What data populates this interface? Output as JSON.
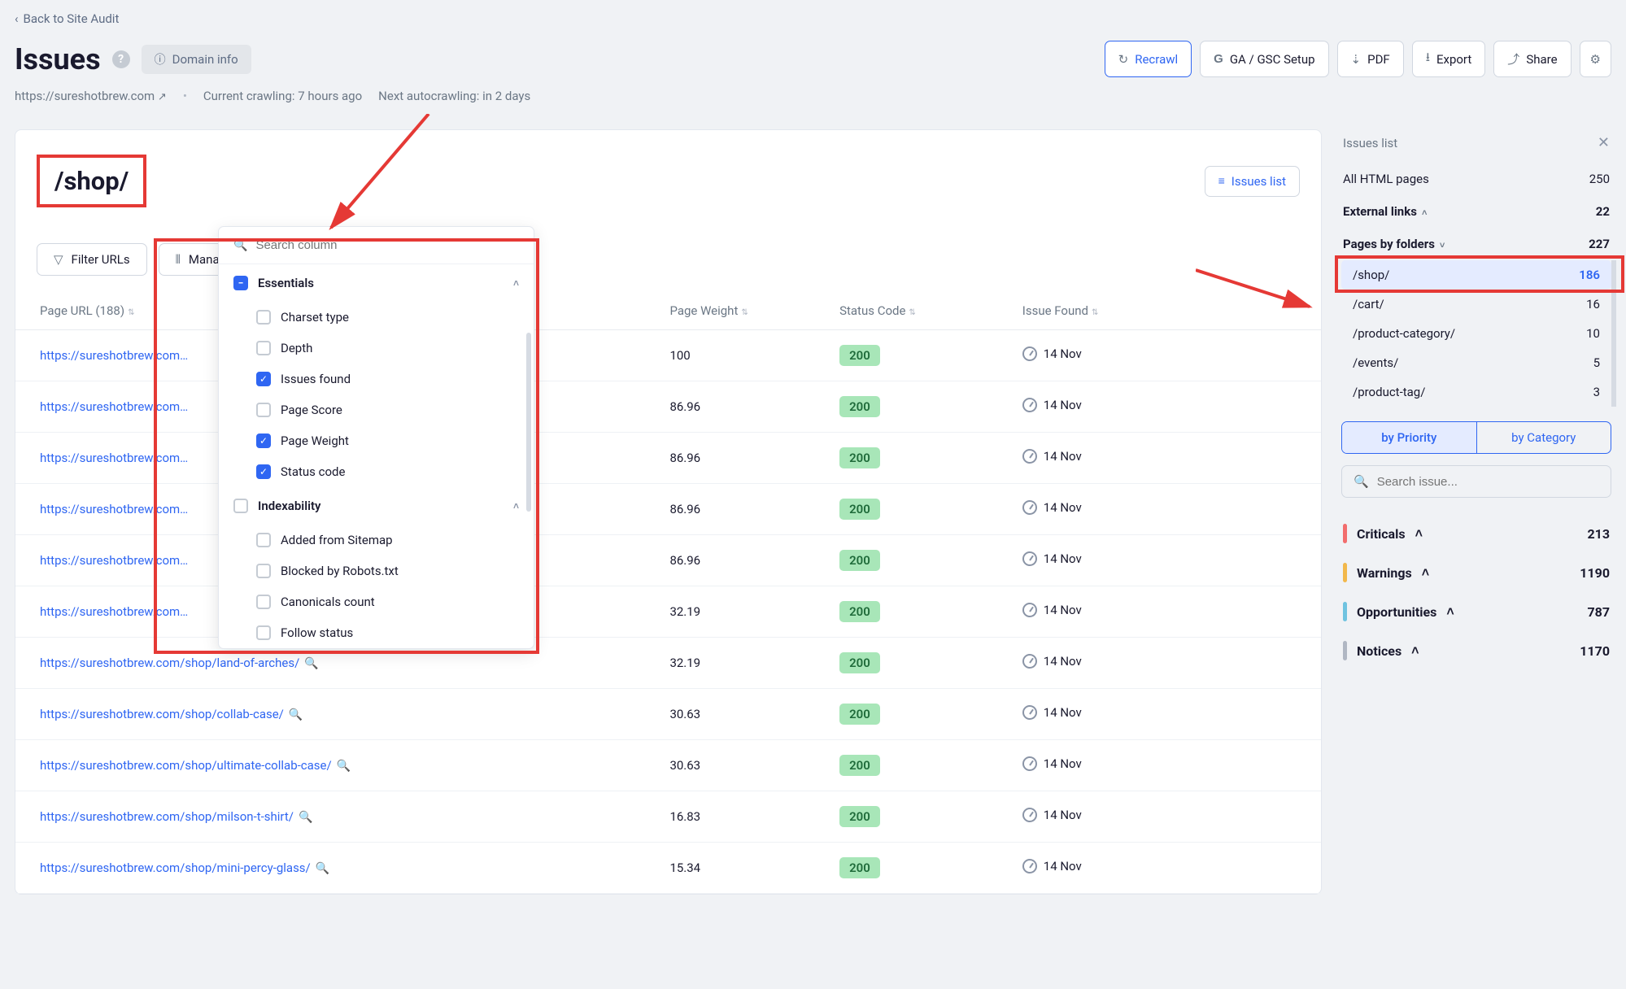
{
  "header": {
    "back": "Back to Site Audit",
    "title": "Issues",
    "domain_chip": "Domain info",
    "buttons": {
      "recrawl": "Recrawl",
      "ga_gsc": "GA / GSC Setup",
      "pdf": "PDF",
      "export": "Export",
      "share": "Share"
    },
    "meta": {
      "domain": "https://sureshotbrew.com",
      "crawling": "Current crawling: 7 hours ago",
      "autocrawl": "Next autocrawling: in 2 days"
    }
  },
  "main": {
    "folder_title": "/shop/",
    "issues_list_btn": "Issues list",
    "filter_btn": "Filter URLs",
    "manage_btn": "Manage columns",
    "table_headers": {
      "url": "Page URL (188)",
      "weight": "Page Weight",
      "status": "Status Code",
      "issue": "Issue Found"
    },
    "rows": [
      {
        "url": "https://sureshotbrew.com",
        "truncated": true,
        "weight": "100",
        "status": "200",
        "date": "14 Nov"
      },
      {
        "url": "https://sureshotbrew.com",
        "truncated": true,
        "weight": "86.96",
        "status": "200",
        "date": "14 Nov"
      },
      {
        "url": "https://sureshotbrew.com",
        "truncated": true,
        "weight": "86.96",
        "status": "200",
        "date": "14 Nov"
      },
      {
        "url": "https://sureshotbrew.com",
        "truncated": true,
        "weight": "86.96",
        "status": "200",
        "date": "14 Nov"
      },
      {
        "url": "https://sureshotbrew.com",
        "truncated": true,
        "weight": "86.96",
        "status": "200",
        "date": "14 Nov"
      },
      {
        "url": "https://sureshotbrew.com",
        "truncated": true,
        "weight": "32.19",
        "status": "200",
        "date": "14 Nov"
      },
      {
        "url": "https://sureshotbrew.com/shop/land-of-arches/",
        "truncated": false,
        "weight": "32.19",
        "status": "200",
        "date": "14 Nov"
      },
      {
        "url": "https://sureshotbrew.com/shop/collab-case/",
        "truncated": false,
        "weight": "30.63",
        "status": "200",
        "date": "14 Nov"
      },
      {
        "url": "https://sureshotbrew.com/shop/ultimate-collab-case/",
        "truncated": false,
        "weight": "30.63",
        "status": "200",
        "date": "14 Nov"
      },
      {
        "url": "https://sureshotbrew.com/shop/milson-t-shirt/",
        "truncated": false,
        "weight": "16.83",
        "status": "200",
        "date": "14 Nov"
      },
      {
        "url": "https://sureshotbrew.com/shop/mini-percy-glass/",
        "truncated": false,
        "weight": "15.34",
        "status": "200",
        "date": "14 Nov"
      }
    ]
  },
  "columns_panel": {
    "search_placeholder": "Search column",
    "groups": [
      {
        "name": "Essentials",
        "state": "partial",
        "items": [
          {
            "label": "Charset type",
            "on": false
          },
          {
            "label": "Depth",
            "on": false
          },
          {
            "label": "Issues found",
            "on": true
          },
          {
            "label": "Page Score",
            "on": false
          },
          {
            "label": "Page Weight",
            "on": true
          },
          {
            "label": "Status code",
            "on": true
          }
        ]
      },
      {
        "name": "Indexability",
        "state": "empty",
        "items": [
          {
            "label": "Added from Sitemap",
            "on": false
          },
          {
            "label": "Blocked by Robots.txt",
            "on": false
          },
          {
            "label": "Canonicals count",
            "on": false
          },
          {
            "label": "Follow status",
            "on": false
          }
        ]
      }
    ]
  },
  "sidebar": {
    "head": "Issues list",
    "all_pages": {
      "label": "All HTML pages",
      "count": "250"
    },
    "external": {
      "label": "External links",
      "count": "22"
    },
    "pages_by_folders": {
      "label": "Pages by folders",
      "count": "227"
    },
    "folders": [
      {
        "name": "/shop/",
        "count": "186",
        "active": true
      },
      {
        "name": "/cart/",
        "count": "16"
      },
      {
        "name": "/product-category/",
        "count": "10"
      },
      {
        "name": "/events/",
        "count": "5"
      },
      {
        "name": "/product-tag/",
        "count": "3"
      }
    ],
    "seg": {
      "priority": "by Priority",
      "category": "by Category"
    },
    "search_placeholder": "Search issue...",
    "severities": [
      {
        "label": "Criticals",
        "count": "213",
        "color": "#f26d6d"
      },
      {
        "label": "Warnings",
        "count": "1190",
        "color": "#f2b84b"
      },
      {
        "label": "Opportunities",
        "count": "787",
        "color": "#6fc3e0"
      },
      {
        "label": "Notices",
        "count": "1170",
        "color": "#b0b7c3"
      }
    ]
  }
}
